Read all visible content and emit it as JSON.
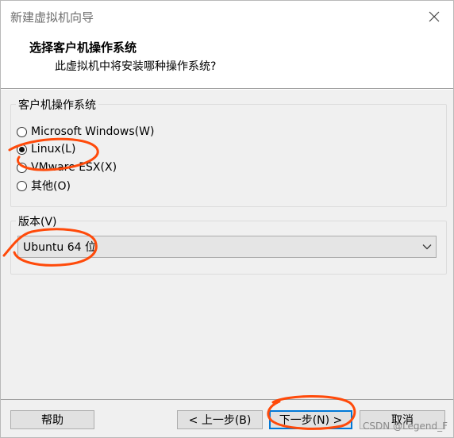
{
  "window": {
    "title": "新建虚拟机向导",
    "close_icon": "close-icon"
  },
  "header": {
    "title": "选择客户机操作系统",
    "subtitle": "此虚拟机中将安装哪种操作系统?"
  },
  "os_group": {
    "legend": "客户机操作系统",
    "options": [
      {
        "label": "Microsoft Windows(W)",
        "checked": false
      },
      {
        "label": "Linux(L)",
        "checked": true
      },
      {
        "label": "VMware ESX(X)",
        "checked": false
      },
      {
        "label": "其他(O)",
        "checked": false
      }
    ]
  },
  "version_group": {
    "legend": "版本(V)",
    "selected": "Ubuntu 64 位",
    "dropdown_icon": "chevron-down-icon"
  },
  "footer": {
    "help": "帮助",
    "back": "< 上一步(B)",
    "next": "下一步(N) >",
    "cancel": "取消",
    "watermark": "CSDN @Legend_F"
  },
  "colors": {
    "annotation": "#ff4a0a",
    "focus": "#0078d7",
    "panel": "#f0f0f0"
  }
}
